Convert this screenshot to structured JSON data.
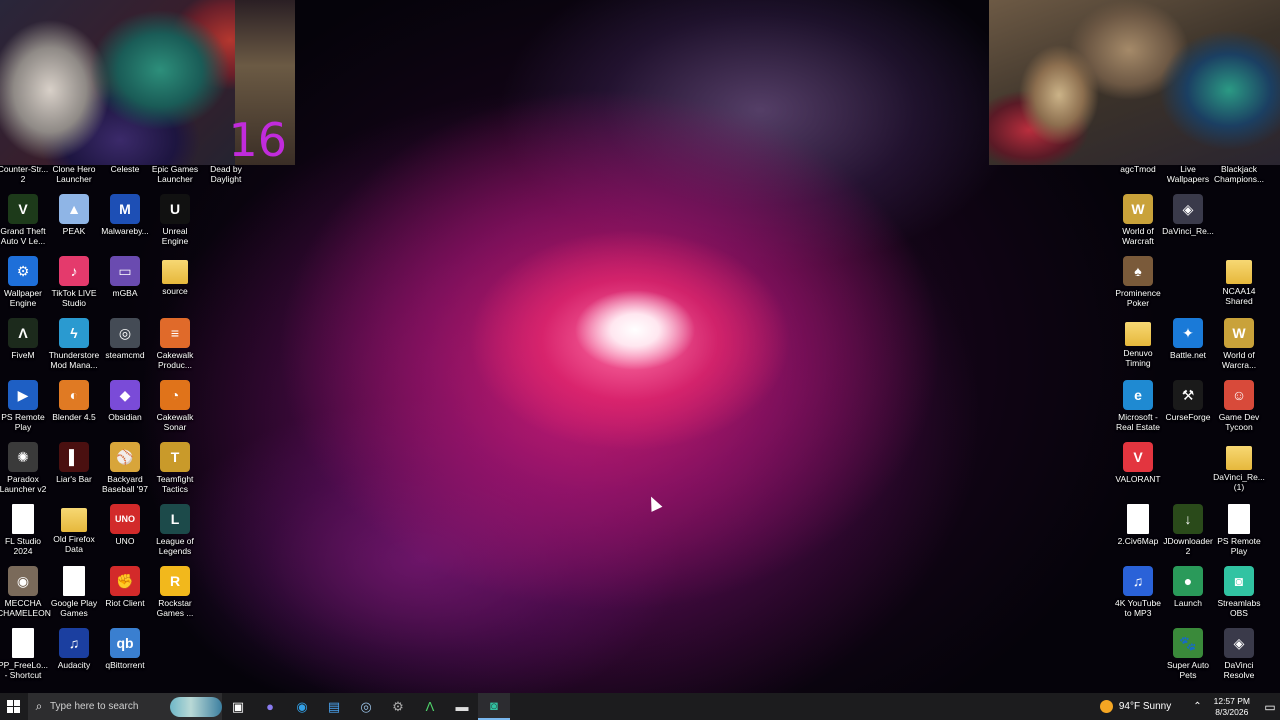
{
  "cam_counter": "16",
  "left_icons": [
    {
      "label": "Counter-Str... 2",
      "name": "counter-strike-icon",
      "color": "#3a3a3a",
      "glyph": ""
    },
    {
      "label": "Clone Hero Launcher",
      "name": "clone-hero-icon",
      "color": "#3a3a3a",
      "glyph": ""
    },
    {
      "label": "Celeste",
      "name": "celeste-icon",
      "color": "#3a3a3a",
      "glyph": ""
    },
    {
      "label": "Epic Games Launcher",
      "name": "epic-games-icon",
      "color": "#3a3a3a",
      "glyph": ""
    },
    {
      "label": "Dead by Daylight",
      "name": "dead-by-daylight-icon",
      "color": "#3a3a3a",
      "glyph": ""
    },
    {
      "label": "Grand Theft Auto V Le...",
      "name": "gta-v-icon",
      "color": "#1d3a1a",
      "glyph": "V"
    },
    {
      "label": "PEAK",
      "name": "peak-icon",
      "color": "#8fb5e6",
      "glyph": "▲"
    },
    {
      "label": "Malwareby...",
      "name": "malwarebytes-icon",
      "color": "#1d4fb5",
      "glyph": "M"
    },
    {
      "label": "Unreal Engine",
      "name": "unreal-engine-icon",
      "color": "#111111",
      "glyph": "U"
    },
    {
      "label": "Wallpaper Engine",
      "name": "wallpaper-engine-icon",
      "color": "#1e6fd9",
      "glyph": "⚙"
    },
    {
      "label": "TikTok LIVE Studio",
      "name": "tiktok-live-icon",
      "color": "#e43a6c",
      "glyph": "♪"
    },
    {
      "label": "mGBA",
      "name": "mgba-icon",
      "color": "#6a4bb0",
      "glyph": "▭"
    },
    {
      "label": "source",
      "name": "source-folder-icon",
      "color": "#e6b83c",
      "glyph": ""
    },
    {
      "label": "FiveM",
      "name": "fivem-icon",
      "color": "#1c2a1c",
      "glyph": "Λ"
    },
    {
      "label": "Thunderstore Mod Mana...",
      "name": "thunderstore-icon",
      "color": "#2a9ad0",
      "glyph": "ϟ"
    },
    {
      "label": "steamcmd",
      "name": "steamcmd-icon",
      "color": "#444b55",
      "glyph": "◎"
    },
    {
      "label": "Cakewalk Produc...",
      "name": "cakewalk-product-icon",
      "color": "#e06a2a",
      "glyph": "≡"
    },
    {
      "label": "PS Remote Play",
      "name": "ps-remote-play-icon",
      "color": "#1e5fc4",
      "glyph": "▶"
    },
    {
      "label": "Blender 4.5",
      "name": "blender-icon",
      "color": "#e07a23",
      "glyph": "◐"
    },
    {
      "label": "Obsidian",
      "name": "obsidian-icon",
      "color": "#7a4bd8",
      "glyph": "◆"
    },
    {
      "label": "Cakewalk Sonar",
      "name": "cakewalk-sonar-icon",
      "color": "#e0731a",
      "glyph": "◔"
    },
    {
      "label": "Paradox Launcher v2",
      "name": "paradox-launcher-icon",
      "color": "#3a3a3a",
      "glyph": "✺"
    },
    {
      "label": "Liar's Bar",
      "name": "liars-bar-icon",
      "color": "#4a1010",
      "glyph": "▌"
    },
    {
      "label": "Backyard Baseball '97",
      "name": "backyard-baseball-icon",
      "color": "#d8a53a",
      "glyph": "⚾"
    },
    {
      "label": "Teamfight Tactics",
      "name": "teamfight-tactics-icon",
      "color": "#c99a2a",
      "glyph": "T"
    },
    {
      "label": "FL Studio 2024",
      "name": "fl-studio-icon",
      "color": "#ffffff",
      "glyph": ""
    },
    {
      "label": "Old Firefox Data",
      "name": "old-firefox-data-icon",
      "color": "#e6b83c",
      "glyph": ""
    },
    {
      "label": "UNO",
      "name": "uno-icon",
      "color": "#d22a2a",
      "glyph": "UNO"
    },
    {
      "label": "League of Legends",
      "name": "league-of-legends-icon",
      "color": "#1c4a4a",
      "glyph": "L"
    },
    {
      "label": "MECCHA CHAMELEON",
      "name": "meccha-chameleon-icon",
      "color": "#7a6a5a",
      "glyph": "◉"
    },
    {
      "label": "Google Play Games",
      "name": "google-play-games-icon",
      "color": "#ffffff",
      "glyph": ""
    },
    {
      "label": "Riot Client",
      "name": "riot-client-icon",
      "color": "#d32a2a",
      "glyph": "✊"
    },
    {
      "label": "Rockstar Games ...",
      "name": "rockstar-games-icon",
      "color": "#f2b81c",
      "glyph": "R"
    },
    {
      "label": "PP_FreeLo... - Shortcut",
      "name": "pp-freelo-shortcut-icon",
      "color": "#ffffff",
      "glyph": ""
    },
    {
      "label": "Audacity",
      "name": "audacity-icon",
      "color": "#1b3fa0",
      "glyph": "♫"
    },
    {
      "label": "qBittorrent",
      "name": "qbittorrent-icon",
      "color": "#3a7fd0",
      "glyph": "qb"
    }
  ],
  "right_icons": [
    {
      "label": "agcTmod",
      "name": "agctmod-icon",
      "color": "#3a3a3a",
      "glyph": ""
    },
    {
      "label": "Live Wallpapers",
      "name": "live-wallpapers-icon",
      "color": "#3a3a3a",
      "glyph": ""
    },
    {
      "label": "Blackjack Champions...",
      "name": "blackjack-champions-icon",
      "color": "#3a3a3a",
      "glyph": ""
    },
    {
      "label": "World of Warcraft",
      "name": "world-of-warcraft-icon",
      "color": "#c9a23a",
      "glyph": "W"
    },
    {
      "label": "DaVinci_Re...",
      "name": "davinci-re-icon",
      "color": "#3a3a4a",
      "glyph": "◈"
    },
    {
      "label": "Prominence Poker",
      "name": "prominence-poker-icon",
      "color": "#7a5a3a",
      "glyph": "♠"
    },
    {
      "label": "NCAA14 Shared",
      "name": "ncaa14-shared-icon",
      "color": "#e6b83c",
      "glyph": ""
    },
    {
      "label": "Denuvo Timing",
      "name": "denuvo-timing-icon",
      "color": "#e6b83c",
      "glyph": ""
    },
    {
      "label": "Battle.net",
      "name": "battle-net-icon",
      "color": "#1a7ad8",
      "glyph": "✦"
    },
    {
      "label": "World of Warcra...",
      "name": "world-of-warcraft-2-icon",
      "color": "#c9a23a",
      "glyph": "W"
    },
    {
      "label": "Microsoft - Real Estate",
      "name": "microsoft-real-estate-icon",
      "color": "#1f8ad2",
      "glyph": "e"
    },
    {
      "label": "CurseForge",
      "name": "curseforge-icon",
      "color": "#1a1a1a",
      "glyph": "⚒"
    },
    {
      "label": "Game Dev Tycoon",
      "name": "game-dev-tycoon-icon",
      "color": "#d84a3a",
      "glyph": "☺"
    },
    {
      "label": "VALORANT",
      "name": "valorant-icon",
      "color": "#e3353f",
      "glyph": "V"
    },
    {
      "label": "DaVinci_Re... (1)",
      "name": "davinci-re-1-icon",
      "color": "#e6c85a",
      "glyph": ""
    },
    {
      "label": "2.Civ6Map",
      "name": "civ6map-icon",
      "color": "#ffffff",
      "glyph": ""
    },
    {
      "label": "JDownloader 2",
      "name": "jdownloader-icon",
      "color": "#2a4a1a",
      "glyph": "↓"
    },
    {
      "label": "PS Remote Play",
      "name": "ps-remote-play-2-icon",
      "color": "#ffffff",
      "glyph": ""
    },
    {
      "label": "4K YouTube to MP3",
      "name": "4k-youtube-mp3-icon",
      "color": "#2a62d8",
      "glyph": "♫"
    },
    {
      "label": "Launch",
      "name": "launch-icon",
      "color": "#2a9a5a",
      "glyph": "●"
    },
    {
      "label": "Streamlabs OBS",
      "name": "streamlabs-obs-icon",
      "color": "#31c3a2",
      "glyph": "◙"
    },
    {
      "label": "Super Auto Pets",
      "name": "super-auto-pets-icon",
      "color": "#3a8a3a",
      "glyph": "🐾"
    },
    {
      "label": "DaVinci Resolve",
      "name": "davinci-resolve-icon",
      "color": "#3a3a4a",
      "glyph": "◈"
    }
  ],
  "taskbar": {
    "search_placeholder": "Type here to search",
    "weather": "94°F  Sunny",
    "time": "12:57 PM",
    "date": "8/3/2026"
  }
}
